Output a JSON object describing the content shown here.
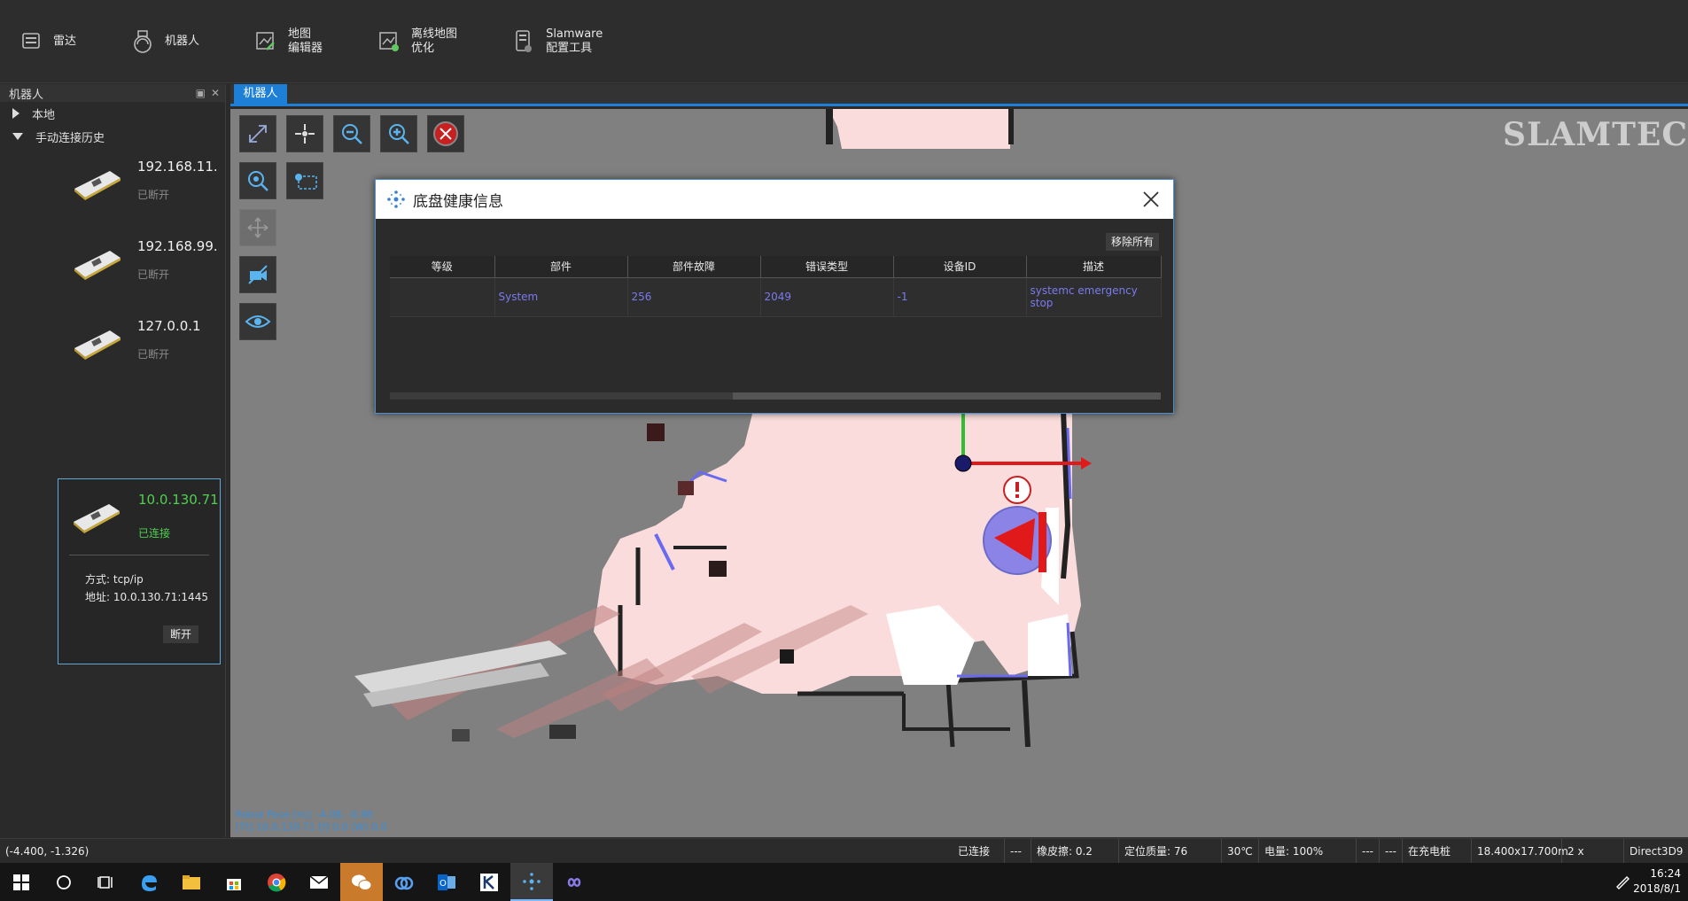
{
  "toolbar": {
    "items": [
      {
        "label": "雷达"
      },
      {
        "label": "机器人"
      },
      {
        "label": "地图\n编辑器"
      },
      {
        "label": "离线地图\n优化"
      },
      {
        "label": "Slamware\n配置工具"
      }
    ]
  },
  "left_panel": {
    "title": "机器人",
    "tree": {
      "local": "本地",
      "history": "手动连接历史"
    },
    "connections": [
      {
        "ip": "192.168.11.",
        "status": "已断开"
      },
      {
        "ip": "192.168.99.",
        "status": "已断开"
      },
      {
        "ip": "127.0.0.1",
        "status": "已断开"
      }
    ],
    "active": {
      "ip": "10.0.130.71",
      "status": "已连接",
      "method": "方式: tcp/ip",
      "address": "地址: 10.0.130.71:1445",
      "disconnect": "断开"
    }
  },
  "main": {
    "tab": "机器人",
    "logo": "SLAMTEC",
    "overlay_line1": "Robot Pose [m]: -4.08, -0.88",
    "overlay_line2": "[Tt] 10.0.130.71 [f] 0.0 (W) 0.0"
  },
  "dialog": {
    "title": "底盘健康信息",
    "remove_all": "移除所有",
    "columns": [
      "等级",
      "部件",
      "部件故障",
      "错误类型",
      "设备ID",
      "描述"
    ],
    "rows": [
      [
        "",
        "System",
        "256",
        "2049",
        "-1",
        "systemc emergency stop"
      ]
    ]
  },
  "status_bar": {
    "coords": "(-4.400, -1.326)",
    "connected": "已连接",
    "dash1": "---",
    "rubber": "橡皮擦: 0.2",
    "loc_quality": "定位质量: 76",
    "temp": "30℃",
    "battery": "电量: 100%",
    "dash2": "---",
    "dash3": "---",
    "charging": "在充电桩",
    "map_size": "18.400x17.700m",
    "zoom": "2 x",
    "renderer": "Direct3D9"
  },
  "taskbar": {
    "time": "16:24",
    "date": "2018/8/1"
  },
  "colors": {
    "accent": "#1d7fd6",
    "connected": "#4fd04f",
    "fault_text": "#7a7aef"
  }
}
